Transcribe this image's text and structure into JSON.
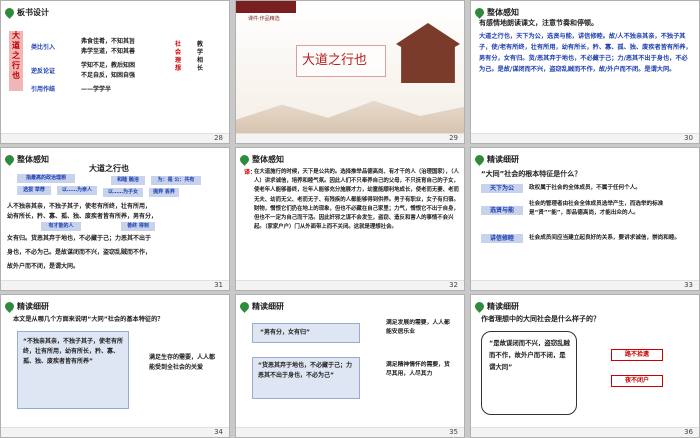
{
  "slides": [
    {
      "number": "28",
      "title": "板书设计",
      "left_col": [
        "大",
        "道",
        "之",
        "行",
        "也"
      ],
      "vertical_bar": "社会理想",
      "rows": [
        {
          "label": "类比引入",
          "content": "弗食佳肴，不知其旨"
        },
        {
          "label": "",
          "content": "弗学至道，不知其善"
        },
        {
          "label": "逆反论证",
          "content": "学知不足，教后知困"
        },
        {
          "label": "",
          "content": "不足自反，知困自强"
        },
        {
          "label": "引用作结",
          "content": "——学学半"
        }
      ],
      "right_col": "教学相长"
    },
    {
      "number": "29",
      "banner": "大道之行也",
      "subbanner": "课件·作品精选"
    },
    {
      "number": "30",
      "title": "整体感知",
      "heading": "有感情地朗读课文，注意节奏和停顿。",
      "text": "大道之行也，天下为公，选贤与能，讲信修睦。故/人不独亲其亲，不独子其子，使/老有所终，壮有所用，幼有所长，矜、寡、孤、独、废疾者皆有所养，男有分，女有归。货/恶其弃于地也，不必藏于己；力/恶其不出于身也，不必为己。是故/谋闭而不兴，盗窃乱贼而不作，故/外户而不闭。是谓大同。"
    },
    {
      "number": "31",
      "title": "整体感知",
      "heading": "大道之行也",
      "notes": [
        "指最高的政治理想",
        "选拔 举荐",
        "和睦 融洽",
        "为：是 公：共有",
        "以……为亲人",
        "以……为子女",
        "抛弃 丢弃",
        "有才能的人",
        "善终 得到"
      ],
      "line1": "人不独亲其亲，不独子其子，使老有所终，壮有所用，",
      "line2": "幼有所长，矜、寡、孤、独、废疾者皆有所养，男有分，",
      "line3": "女有归。货恶其弃于地也，不必藏于己；力恶其不出于",
      "line4": "身也，不必为己。是故谋闭而不兴，盗窃乱贼而不作，",
      "line5": "故外户而不闭，是谓大同。"
    },
    {
      "number": "32",
      "title": "整体感知",
      "label": "译：",
      "text": "在大道施行的时候，天下是公共的。选择推举品德高尚、有才干的人（治理国家），（人人）讲求诚信，培养和睦气氛。因此人们不只奉养自己的父母，不只抚育自己的子女，使老年人能够善终，壮年人能够充分施展才力，幼童能顺利地成长，使老而无妻、老而无夫、幼而无父、老而无子、有残疾的人都能够得到供养。男子有职业，女子有归宿。财物，憎恨它们扔在地上的现象，但也不必藏在自己家里；力气，憎恨它不出于自身，但也不一定为自己而干活。因此奸邪之谋不会发生，盗窃、造反和害人的事情不会兴起。（家家户户）门从外面带上而不关闭。这就是理想社会。"
    },
    {
      "number": "33",
      "title": "精读细研",
      "question": "“大同”社会的根本特征是什么？",
      "items": [
        {
          "key": "天下为公",
          "value": "政权属于社会的全体成员，不属于任何个人。"
        },
        {
          "key": "选贤与能",
          "value": "社会的管理者由社会全体成员选举产生，而选举的标准是“贤”“能”，即品德高尚，才能出众的人。"
        },
        {
          "key": "讲信修睦",
          "value": "社会成员间应当建立起良好的关系，要讲求诚信，崇尚和睦。"
        }
      ]
    },
    {
      "number": "34",
      "title": "精读细研",
      "question": "本文是从哪几个方面来说明“大同”社会的基本特征的？",
      "quote": "“不独亲其亲，不独子其子，使老有所终，壮有所用，幼有所长，矜、寡、孤、独、废疾者皆有所养”",
      "answer": "满足生存的需要，人人都能受到全社会的关爱"
    },
    {
      "number": "35",
      "title": "精读细研",
      "pairs": [
        {
          "quote": "“男有分，女有归”",
          "answer": "满足发展的需要，人人都能安居乐业"
        },
        {
          "quote": "“货恶其弃于地也，不必藏于己；力恶其不出于身也，不必为己”",
          "answer": "满足精神情怀的需要，货尽其用，人尽其力"
        }
      ]
    },
    {
      "number": "36",
      "title": "精读细研",
      "question": "作者理想中的大同社会是什么样子的？",
      "quote": "“是故谋闭而不兴，盗窃乱贼而不作，故外户而不闭，是谓大同”",
      "tags": [
        "路不拾遗",
        "夜不闭户"
      ]
    }
  ]
}
